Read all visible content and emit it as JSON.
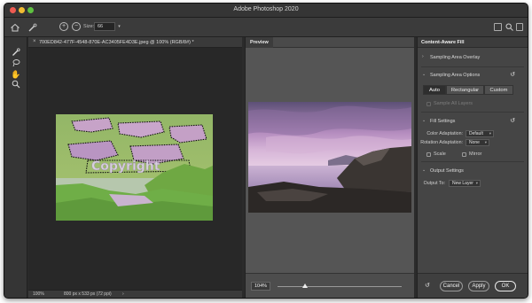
{
  "window": {
    "title": "Adobe Photoshop 2020"
  },
  "options_bar": {
    "size_label": "Size:",
    "size_value": "66",
    "icons": [
      "home-icon",
      "spot-healing-brush-icon",
      "add-to-mask-icon",
      "subtract-from-mask-icon",
      "window-icon",
      "search-icon",
      "workspace-icon"
    ]
  },
  "tools": [
    "spot-healing-brush-tool-icon",
    "lasso-tool-icon",
    "hand-tool-icon",
    "zoom-tool-icon"
  ],
  "document": {
    "tab_title": "700ED842-477F-4548-870E-AC3405FE4D3E.jpeg @ 100% (RGB/8#) *",
    "close_glyph": "×",
    "status_zoom": "100%",
    "status_info": "800 px x 533 px (72 ppi)",
    "status_arrow": "›",
    "watermark": "Copyright"
  },
  "preview_panel": {
    "tab": "Preview",
    "zoom_value": "104%"
  },
  "caf_panel": {
    "tab": "Content-Aware Fill",
    "sampling_overlay": "Sampling Area Overlay",
    "sampling_options": "Sampling Area Options",
    "seg_auto": "Auto",
    "seg_rect": "Rectangular",
    "seg_custom": "Custom",
    "sample_all_layers": "Sample All Layers",
    "fill_settings": "Fill Settings",
    "color_adaptation_label": "Color Adaptation:",
    "color_adaptation_value": "Default",
    "rotation_adaptation_label": "Rotation Adaptation:",
    "rotation_adaptation_value": "None",
    "scale": "Scale",
    "mirror": "Mirror",
    "output_settings": "Output Settings",
    "output_to_label": "Output To:",
    "output_to_value": "New Layer",
    "cancel": "Cancel",
    "apply": "Apply",
    "ok": "OK"
  },
  "colors": {
    "overlay_green": "#7fbf55",
    "sky_purple": "#b98fbf",
    "app_dark": "#2b2b2b"
  }
}
